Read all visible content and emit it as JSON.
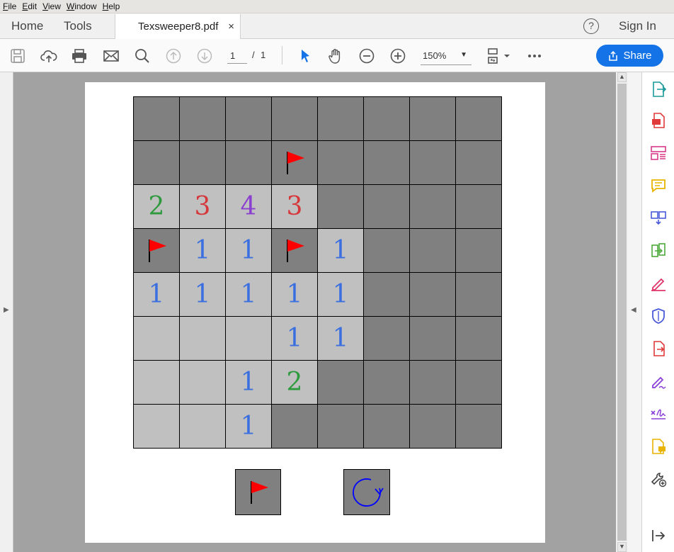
{
  "menubar": {
    "items": [
      {
        "label": "File",
        "key": "F",
        "rest": "ile"
      },
      {
        "label": "Edit",
        "key": "E",
        "rest": "dit"
      },
      {
        "label": "View",
        "key": "V",
        "rest": "iew"
      },
      {
        "label": "Window",
        "key": "W",
        "rest": "indow"
      },
      {
        "label": "Help",
        "key": "H",
        "rest": "elp"
      }
    ]
  },
  "tabbar": {
    "home_label": "Home",
    "tools_label": "Tools",
    "document_tab": "Texsweeper8.pdf",
    "close_glyph": "×",
    "help_glyph": "?",
    "sign_in_label": "Sign In"
  },
  "toolbar": {
    "page_current": "1",
    "page_separator": "/",
    "page_total": "1",
    "zoom": "150%",
    "share_label": "Share",
    "accent": "#1473e6"
  },
  "board": {
    "rows": 8,
    "cols": 8,
    "cells": [
      [
        "C",
        "C",
        "C",
        "C",
        "C",
        "C",
        "C",
        "C"
      ],
      [
        "C",
        "C",
        "C",
        "F",
        "C",
        "C",
        "C",
        "C"
      ],
      [
        "2",
        "3",
        "4",
        "3",
        "C",
        "C",
        "C",
        "C"
      ],
      [
        "F",
        "1",
        "1",
        "F",
        "1",
        "C",
        "C",
        "C"
      ],
      [
        "1",
        "1",
        "1",
        "1",
        "1",
        "C",
        "C",
        "C"
      ],
      [
        "E",
        "E",
        "E",
        "1",
        "1",
        "C",
        "C",
        "C"
      ],
      [
        "E",
        "E",
        "1",
        "2",
        "C",
        "C",
        "C",
        "C"
      ],
      [
        "E",
        "E",
        "1",
        "C",
        "C",
        "C",
        "C",
        "C"
      ]
    ],
    "number_colors": {
      "1": "#3b6fe0",
      "2": "#2e9a3e",
      "3": "#d5373a",
      "4": "#8b3fcf"
    },
    "covered_color": "#808080",
    "open_color": "#c0c0c0",
    "flag_color": "#ff0000"
  },
  "controls": {
    "flag_button_icon": "flag-icon",
    "reset_button_icon": "refresh-icon"
  }
}
